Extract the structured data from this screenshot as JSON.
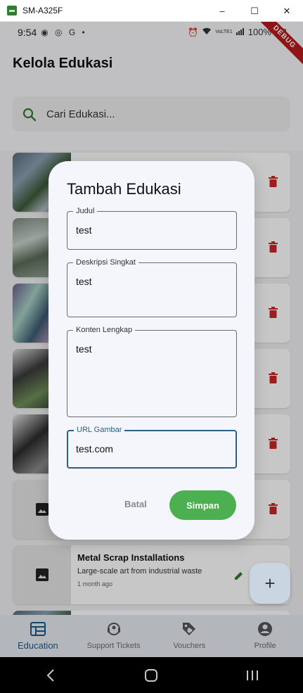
{
  "window": {
    "title": "SM-A325F",
    "minimize": "–",
    "maximize": "☐",
    "close": "✕"
  },
  "status_bar": {
    "time": "9:54",
    "left_icons": "◉ ◎ G •",
    "network": "VoLTE1",
    "battery": "100%",
    "debug_banner": "DEBUG"
  },
  "app": {
    "title": "Kelola Edukasi"
  },
  "search": {
    "placeholder": "Cari Edukasi..."
  },
  "list": [
    {
      "thumb": "photo",
      "title": "",
      "description": "",
      "time": ""
    },
    {
      "thumb": "photo",
      "title": "",
      "description": "",
      "time": ""
    },
    {
      "thumb": "photo",
      "title": "",
      "description": "",
      "time": ""
    },
    {
      "thumb": "photo",
      "title": "",
      "description": "",
      "time": ""
    },
    {
      "thumb": "photo",
      "title": "",
      "description": "",
      "time": ""
    },
    {
      "thumb": "image-placeholder-icon",
      "title": "",
      "description": "",
      "time": ""
    },
    {
      "thumb": "image-placeholder-icon",
      "title": "Metal Scrap Installations",
      "description": "Large-scale art from industrial waste",
      "time": "1 month ago"
    }
  ],
  "fab": {
    "label": "+"
  },
  "bottom_nav": [
    {
      "label": "Education",
      "icon": "education-icon",
      "active": true
    },
    {
      "label": "Support Tickets",
      "icon": "support-icon",
      "active": false
    },
    {
      "label": "Vouchers",
      "icon": "voucher-tag-icon",
      "active": false
    },
    {
      "label": "Profile",
      "icon": "profile-icon",
      "active": false
    }
  ],
  "dialog": {
    "title": "Tambah Edukasi",
    "fields": [
      {
        "label": "Judul",
        "value": "test"
      },
      {
        "label": "Deskripsi Singkat",
        "value": "test"
      },
      {
        "label": "Konten Lengkap",
        "value": "test"
      },
      {
        "label": "URL Gambar",
        "value": "test.com"
      }
    ],
    "cancel_label": "Batal",
    "save_label": "Simpan"
  },
  "colors": {
    "accent_green": "#4caf50",
    "focus_blue": "#2a5f86",
    "delete_red": "#c62828",
    "nav_active": "#1c5a8a"
  }
}
